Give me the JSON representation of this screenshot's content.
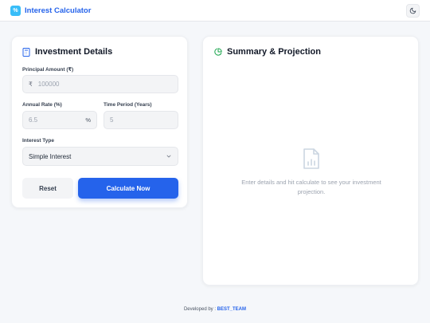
{
  "header": {
    "title": "Interest Calculator",
    "brand_icon": "percent-icon",
    "theme_icon": "moon-icon"
  },
  "investment": {
    "title": "Investment Details",
    "title_icon": "calculator-icon",
    "principal": {
      "label": "Principal Amount (₹)",
      "prefix": "₹",
      "placeholder": "100000"
    },
    "rate": {
      "label": "Annual Rate (%)",
      "placeholder": "6.5",
      "suffix": "%"
    },
    "period": {
      "label": "Time Period (Years)",
      "placeholder": "5"
    },
    "interest_type": {
      "label": "Interest Type",
      "selected": "Simple Interest"
    },
    "reset_label": "Reset",
    "calculate_label": "Calculate Now"
  },
  "summary": {
    "title": "Summary & Projection",
    "title_icon": "pie-chart-icon",
    "empty_icon": "file-chart-icon",
    "empty_message": "Enter details and hit calculate to see your investment projection."
  },
  "footer": {
    "prefix": "Developed by :",
    "team": "BEST_TEAM"
  },
  "colors": {
    "accent": "#2563eb",
    "brand_icon_bg": "#38bdf8",
    "background": "#f5f7fa",
    "card": "#ffffff"
  }
}
